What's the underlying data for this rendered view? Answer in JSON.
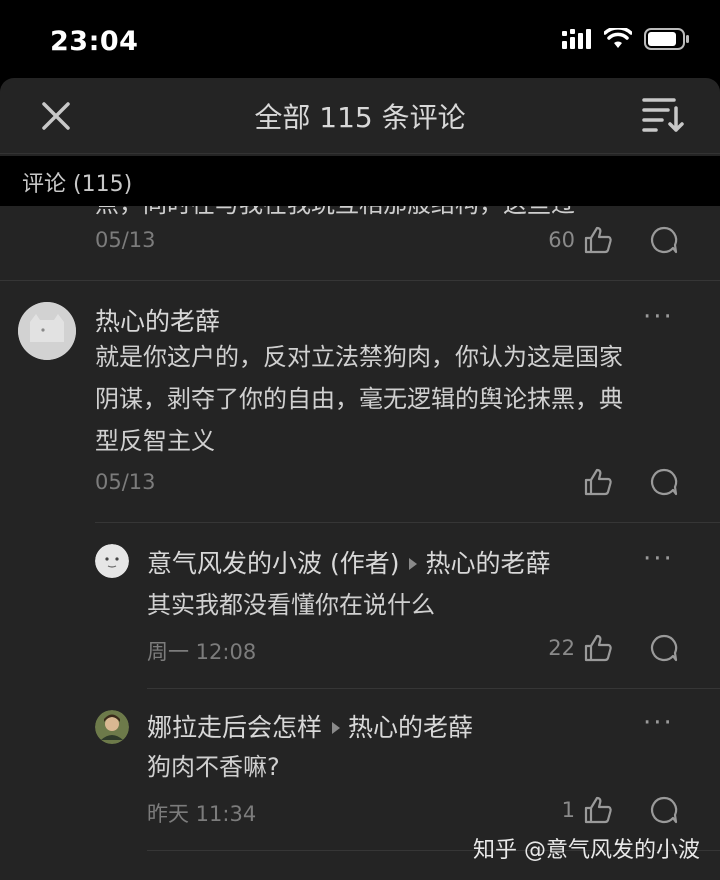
{
  "status": {
    "time": "23:04"
  },
  "header": {
    "title": "全部 115 条评论"
  },
  "section": {
    "label": "评论 (115)"
  },
  "prev_comment": {
    "partial_text": "点，同时在与我在我玩互相那般结构，这些过",
    "date": "05/13",
    "likes": "60"
  },
  "comments": [
    {
      "author": "热心的老薛",
      "text": "就是你这户的，反对立法禁狗肉，你认为这是国家阴谋，剥夺了你的自由，毫无逻辑的舆论抹黑，典型反智主义",
      "line1": "就是你这户的，反对立法禁狗肉，你认为这是国家",
      "line2": "阴谋，剥夺了你的自由，毫无逻辑的舆论抹黑，典",
      "line3": "型反智主义",
      "date": "05/13",
      "likes": "",
      "replies": [
        {
          "author": "意气风发的小波 (作者)",
          "reply_to": "热心的老薛",
          "text": "其实我都没看懂你在说什么",
          "date": "周一 12:08",
          "likes": "22"
        },
        {
          "author": "娜拉走后会怎样",
          "reply_to": "热心的老薛",
          "text": "狗肉不香嘛?",
          "date": "昨天 11:34",
          "likes": "1"
        }
      ]
    }
  ],
  "more_label": "···",
  "watermark": "知乎 @意气风发的小波",
  "colors": {
    "background": "#000000",
    "sheet": "#242424",
    "text": "#d0d0d0",
    "muted": "#7c7c7c"
  },
  "icons": [
    "close-icon",
    "sort-icon",
    "like-icon",
    "comment-icon",
    "signal-icon",
    "wifi-icon",
    "battery-icon"
  ]
}
